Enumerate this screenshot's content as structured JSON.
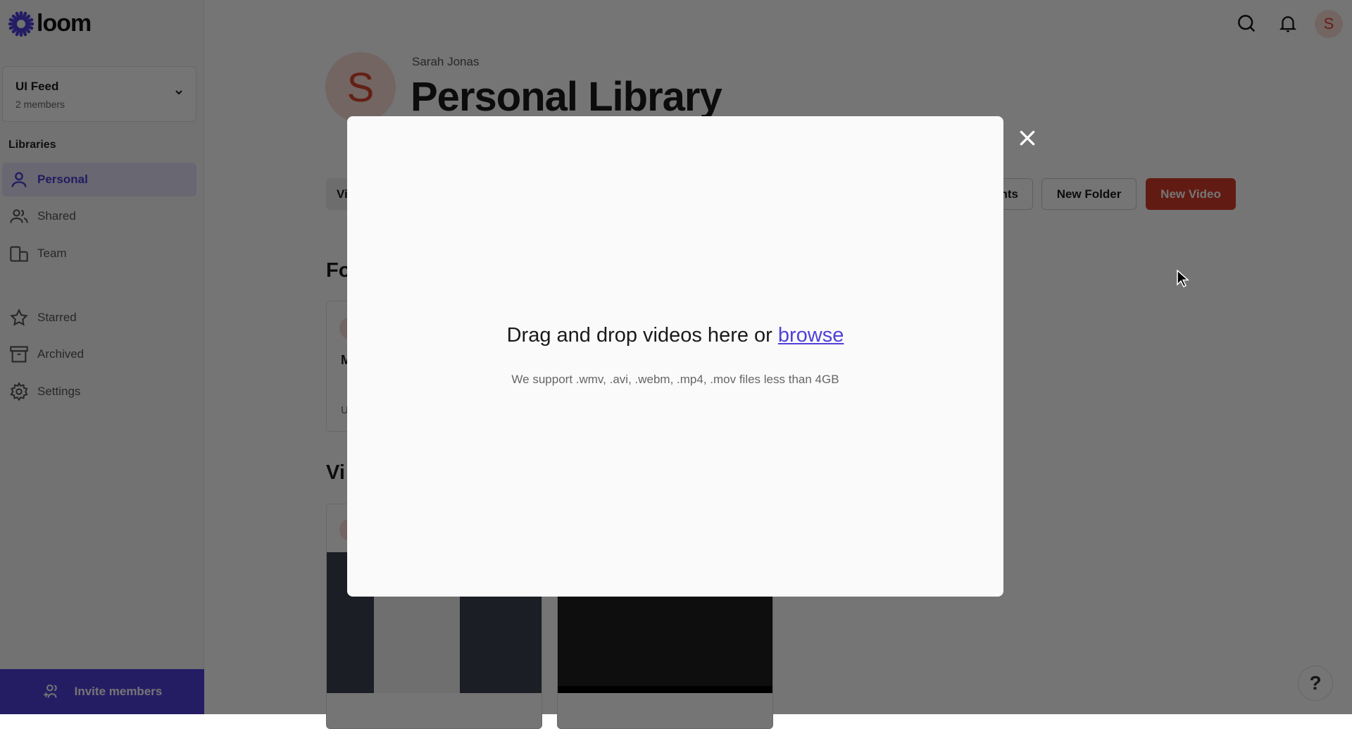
{
  "brand": {
    "name": "loom",
    "color": "#5140d9"
  },
  "workspace": {
    "name": "UI Feed",
    "members": "2 members"
  },
  "sidebar": {
    "section_label": "Libraries",
    "items": [
      {
        "label": "Personal",
        "icon": "person-icon",
        "active": true
      },
      {
        "label": "Shared",
        "icon": "people-icon"
      },
      {
        "label": "Team",
        "icon": "building-icon"
      },
      {
        "label": "Starred",
        "icon": "star-icon"
      },
      {
        "label": "Archived",
        "icon": "archive-icon"
      },
      {
        "label": "Settings",
        "icon": "gear-icon"
      }
    ],
    "invite_label": "Invite members"
  },
  "header": {
    "avatar_initial": "S",
    "owner": "Sarah Jonas",
    "title": "Personal Library"
  },
  "toolbar": {
    "tab_partial": "Vi",
    "partial_button": "nts",
    "new_folder": "New Folder",
    "new_video": "New Video",
    "accent": "#d63a2a"
  },
  "sections": {
    "folders_partial": "Fo",
    "videos_partial": "Vi",
    "folder_card_partial_1": "M",
    "folder_card_partial_2": "U"
  },
  "modal": {
    "prompt": "Drag and drop videos here or ",
    "browse": "browse",
    "support": "We support .wmv, .avi, .webm, .mp4, .mov files less than 4GB"
  },
  "help_label": "?"
}
